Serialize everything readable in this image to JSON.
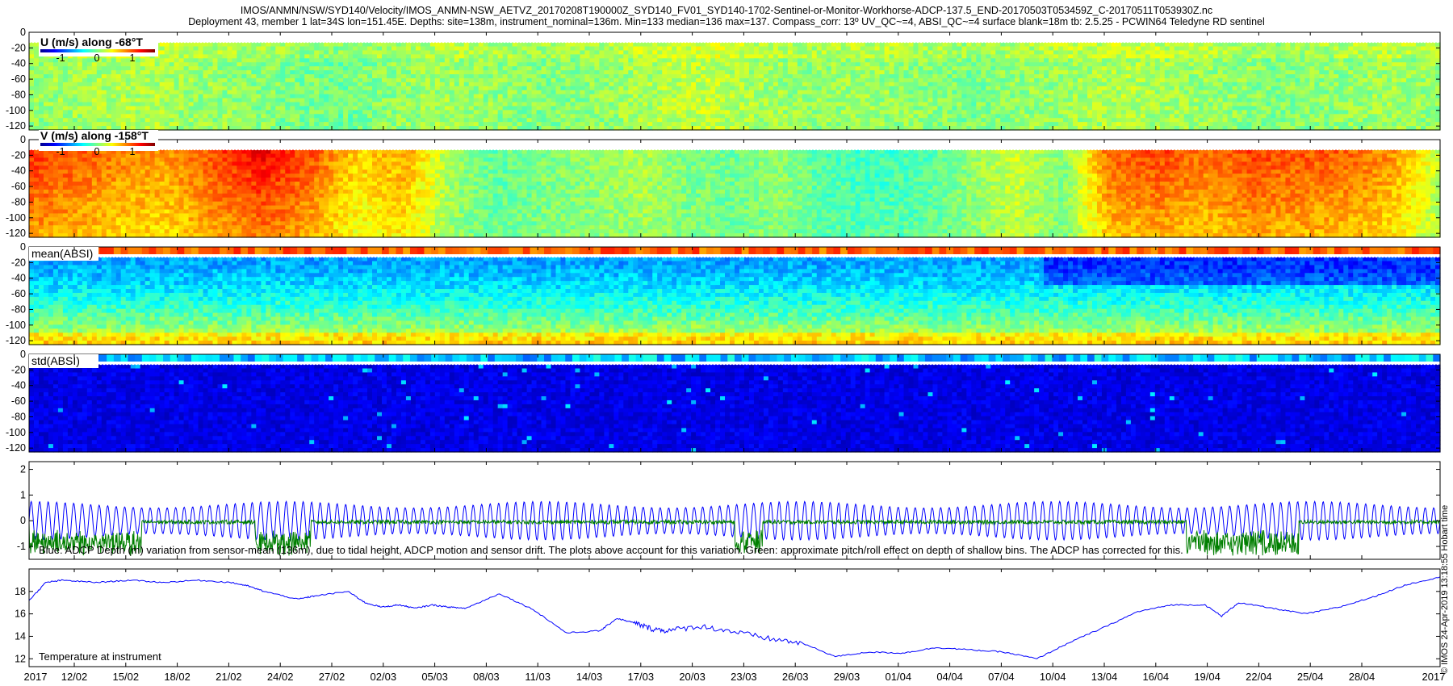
{
  "header": {
    "line1": "IMOS/ANMN/NSW/SYD140/Velocity/IMOS_ANMN-NSW_AETVZ_20170208T190000Z_SYD140_FV01_SYD140-1702-Sentinel-or-Monitor-Workhorse-ADCP-137.5_END-20170503T053459Z_C-20170511T053930Z.nc",
    "line2": "Deployment 43, member 1 lat=34S lon=151.45E. Depths: site=138m, instrument_nominal=136m. Min=133 median=136 max=137. Compass_corr: 13º UV_QC~=4, ABSI_QC~=4 surface blank=18m tb: 2.5.25 - PCWIN64 Teledyne RD sentinel"
  },
  "side_text": "© IMOS 24-Apr-2019 13:18:55 Hobart time",
  "x_ticks": [
    "2017",
    "12/02",
    "15/02",
    "18/02",
    "21/02",
    "24/02",
    "27/02",
    "02/03",
    "05/03",
    "08/03",
    "11/03",
    "14/03",
    "17/03",
    "20/03",
    "23/03",
    "26/03",
    "29/03",
    "01/04",
    "04/04",
    "07/04",
    "10/04",
    "13/04",
    "16/04",
    "19/04",
    "22/04",
    "25/04",
    "28/04",
    "2017"
  ],
  "panels": {
    "u": {
      "title": "U (m/s) along -68°T",
      "y_ticks": [
        "0",
        "-20",
        "-40",
        "-60",
        "-80",
        "-100",
        "-120"
      ],
      "colorbar_ticks": [
        "-1",
        "0",
        "1"
      ]
    },
    "v": {
      "title": "V (m/s) along -158°T",
      "y_ticks": [
        "0",
        "-20",
        "-40",
        "-60",
        "-80",
        "-100",
        "-120"
      ],
      "colorbar_ticks": [
        "-1",
        "0",
        "1"
      ]
    },
    "mean_absi": {
      "title": "mean(ABSI)",
      "y_ticks": [
        "0",
        "-20",
        "-40",
        "-60",
        "-80",
        "-100",
        "-120"
      ]
    },
    "std_absi": {
      "title": "std(ABSI)",
      "y_ticks": [
        "0",
        "-20",
        "-40",
        "-60",
        "-80",
        "-100",
        "-120"
      ]
    },
    "depth": {
      "y_ticks": [
        "2",
        "1",
        "0",
        "-1"
      ],
      "caption": "Blue: ADCP Depth (m) variation from sensor-mean (136m), due to tidal height, ADCP motion and sensor drift. The plots above account for this variation. Green: approximate pitch/roll effect on depth of shallow bins. The ADCP has corrected for this."
    },
    "temperature": {
      "y_ticks": [
        "18",
        "16",
        "14",
        "12"
      ],
      "caption": "Temperature at instrument"
    }
  },
  "colors": {
    "blue_line": "#0000ff",
    "green_line": "#007f00"
  },
  "chart_data": [
    {
      "type": "heatmap",
      "title": "U (m/s) along -68°T",
      "ylim": [
        -125,
        0
      ],
      "colorbar": {
        "ticks": [
          -1,
          0,
          1
        ],
        "range": [
          -1.5,
          1.5
        ]
      },
      "depth_rows": [
        -20,
        -40,
        -60,
        -80,
        -100,
        -120
      ],
      "time_profile": [
        0.05,
        0.1,
        0.15,
        0.1,
        0.05,
        0.0,
        -0.05,
        0.05,
        0.1,
        0.05,
        0.0,
        0.05,
        0.15,
        0.2,
        0.1,
        0.05,
        0.1,
        0.05,
        0.0,
        0.05,
        0.1,
        0.15,
        0.1,
        0.05,
        0.0,
        0.05,
        0.1,
        0.05
      ]
    },
    {
      "type": "heatmap",
      "title": "V (m/s) along -158°T",
      "ylim": [
        -125,
        0
      ],
      "colorbar": {
        "ticks": [
          -1,
          0,
          1
        ],
        "range": [
          -1.5,
          1.5
        ]
      },
      "depth_rows": [
        -20,
        -40,
        -60,
        -80,
        -100,
        -120
      ],
      "time_profile": [
        1.0,
        0.9,
        0.75,
        0.7,
        0.95,
        1.15,
        0.9,
        0.5,
        0.65,
        0.1,
        -0.1,
        0.0,
        0.05,
        0.15,
        0.0,
        -0.05,
        0.05,
        -0.15,
        -0.2,
        -0.15,
        0.05,
        0.25,
        0.0,
        0.85,
        0.95,
        0.8,
        0.95,
        0.9,
        0.85,
        0.7,
        0.2
      ]
    },
    {
      "type": "heatmap",
      "title": "mean(ABSI)",
      "ylim": [
        -125,
        0
      ],
      "depth_rows": [
        -20,
        -40,
        -60,
        -80,
        -100,
        -120
      ]
    },
    {
      "type": "heatmap",
      "title": "std(ABSI)",
      "ylim": [
        -125,
        0
      ],
      "depth_rows": [
        -20,
        -40,
        -60,
        -80,
        -100,
        -120
      ]
    },
    {
      "type": "line",
      "ylim": [
        -1.5,
        2.3
      ],
      "series": [
        {
          "color": "#0000ff",
          "tidal_amplitude_m": [
            0.5,
            0.75
          ]
        },
        {
          "color": "#007f00",
          "typical_range_m": [
            -1.3,
            0.1
          ]
        }
      ]
    },
    {
      "type": "line",
      "ylim": [
        11.3,
        20.0
      ],
      "series": [
        {
          "color": "#0000ff",
          "day_offset": [
            0,
            1,
            2,
            4,
            6,
            8,
            10,
            12,
            13,
            14,
            16,
            17,
            19,
            20,
            21,
            22,
            23,
            24,
            25,
            26,
            28,
            30,
            32,
            34,
            35,
            36,
            37,
            38,
            40,
            42,
            44,
            46,
            48,
            50,
            52,
            54,
            56,
            58,
            60,
            62,
            64,
            66,
            68,
            70,
            71,
            72,
            74,
            76,
            78,
            80,
            82,
            84
          ],
          "temperature": [
            17.2,
            18.8,
            19.0,
            18.8,
            19.0,
            18.8,
            19.0,
            18.8,
            18.5,
            18.0,
            17.3,
            17.6,
            18.0,
            17.0,
            16.6,
            16.8,
            16.5,
            16.8,
            16.6,
            16.5,
            17.8,
            16.4,
            14.3,
            14.5,
            15.6,
            15.2,
            14.7,
            14.5,
            14.9,
            14.4,
            13.8,
            13.4,
            12.2,
            12.6,
            12.5,
            13.0,
            12.8,
            12.6,
            12.0,
            13.5,
            14.8,
            16.2,
            16.8,
            16.8,
            15.8,
            17.0,
            16.5,
            16.0,
            16.6,
            17.5,
            18.6,
            19.3
          ]
        }
      ]
    }
  ]
}
